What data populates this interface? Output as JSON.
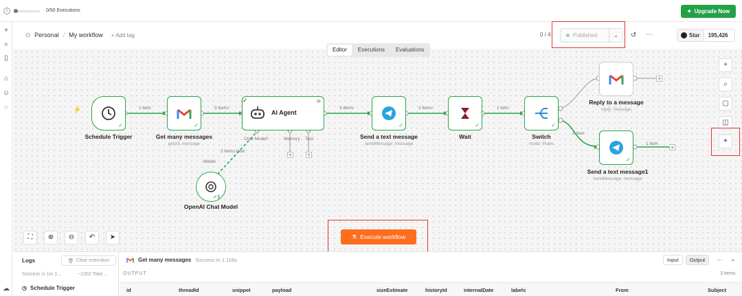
{
  "topbar": {
    "executions": "0/50 Executions",
    "upgrade_label": "Upgrade Now"
  },
  "header": {
    "project": "Personal",
    "workflow": "My workflow",
    "add_tag": "+ Add tag",
    "counter": "0 / 4",
    "published_label": "Published",
    "github_star": "Star",
    "github_count": "195,426"
  },
  "tabs": [
    "Editor",
    "Executions",
    "Evaluations"
  ],
  "nodes": {
    "schedule": {
      "title": "Schedule Trigger"
    },
    "get_messages": {
      "title": "Get many messages",
      "sub": "getAll: message"
    },
    "agent": {
      "title": "AI Agent",
      "ports": [
        "Chat Model*",
        "Memory",
        "Tool"
      ]
    },
    "send_text": {
      "title": "Send a text message",
      "sub": "sendMessage: message"
    },
    "wait": {
      "title": "Wait"
    },
    "switch": {
      "title": "Switch",
      "sub": "mode: Rules"
    },
    "reply": {
      "title": "Reply to a message",
      "sub": "reply: message"
    },
    "send_text1": {
      "title": "Send a text message1",
      "sub": "sendMessage: message"
    },
    "openai": {
      "title": "OpenAI Chat Model",
      "badge": "3"
    }
  },
  "edges": {
    "e1": "1 item",
    "e2": "3 items",
    "e3": "3 items",
    "e4": "3 items",
    "e5": "1 item",
    "e6": "1 item",
    "e7": "1 item",
    "model_total": "3 items total",
    "model_port": "Model"
  },
  "execute_label": "Execute workflow",
  "logs": {
    "title": "Logs",
    "clear": "Clear execution",
    "status": "Success in 1m 1...",
    "tokens": "~1202 Toke...",
    "item": "Schedule Trigger"
  },
  "output": {
    "node": "Get many messages",
    "status": "Success in 1.116s",
    "input_label": "Input",
    "output_label": "Output",
    "section": "OUTPUT",
    "items": "3 items",
    "columns": [
      "id",
      "threadId",
      "snippet",
      "payload",
      "sizeEstimate",
      "historyId",
      "internalDate",
      "labels",
      "From",
      "Subject"
    ]
  },
  "colors": {
    "success": "#27a745",
    "upgrade": "#24a148",
    "execute": "#ff6d1f",
    "highlight": "#e23232",
    "ai_sparkle": "#8b5cf6"
  }
}
